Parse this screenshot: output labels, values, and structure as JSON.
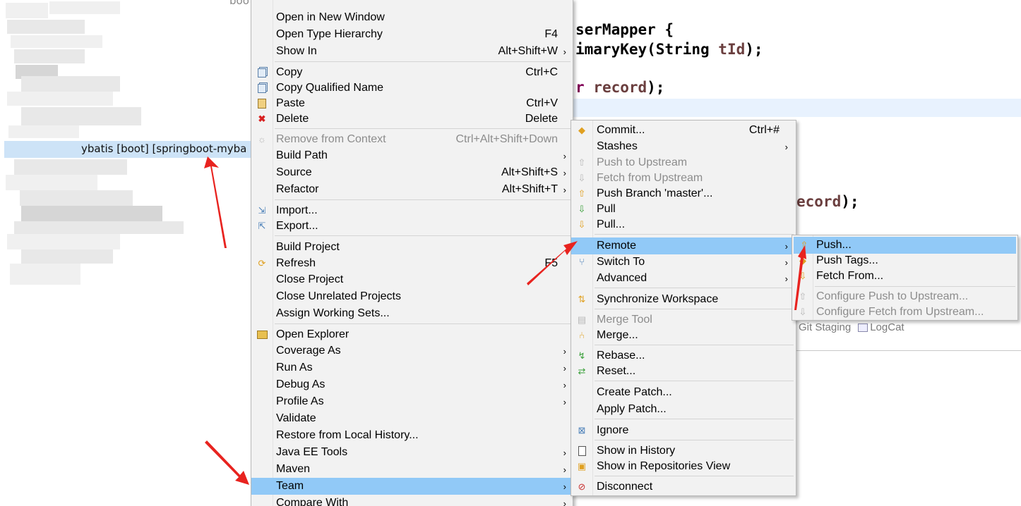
{
  "explorer": {
    "selected_item": "ybatis [boot] [springboot-myba",
    "top_crumb": "boo"
  },
  "editor": {
    "lines": [
      {
        "pre": "serMapper {",
        "kw": "",
        "var": "",
        "post": ""
      },
      {
        "pre": "imaryKey(String ",
        "kw": "",
        "var": "tId",
        "post": ");"
      },
      {
        "pre": "r ",
        "kw": "",
        "var": "record",
        "post": ");"
      },
      {
        "pre": "",
        "kw": "",
        "var": "ecord",
        "post": ");"
      }
    ],
    "views": [
      "Git Staging",
      "LogCat"
    ]
  },
  "context_menu": {
    "items": [
      {
        "label": "Open in New Window",
        "accel": "",
        "arrow": false
      },
      {
        "label": "Open Type Hierarchy",
        "accel": "F4",
        "arrow": false
      },
      {
        "label": "Show In",
        "accel": "Alt+Shift+W",
        "arrow": true
      },
      {
        "label": "Copy",
        "accel": "Ctrl+C",
        "icon": "copy-icon"
      },
      {
        "label": "Copy Qualified Name",
        "accel": "",
        "icon": "copy-icon"
      },
      {
        "label": "Paste",
        "accel": "Ctrl+V",
        "icon": "paste-icon"
      },
      {
        "label": "Delete",
        "accel": "Delete",
        "icon": "delete-icon"
      },
      {
        "label": "Remove from Context",
        "accel": "Ctrl+Alt+Shift+Down",
        "icon": "context-icon",
        "disabled": true
      },
      {
        "label": "Build Path",
        "accel": "",
        "arrow": true
      },
      {
        "label": "Source",
        "accel": "Alt+Shift+S",
        "arrow": true
      },
      {
        "label": "Refactor",
        "accel": "Alt+Shift+T",
        "arrow": true
      },
      {
        "label": "Import...",
        "accel": "",
        "icon": "import-icon"
      },
      {
        "label": "Export...",
        "accel": "",
        "icon": "export-icon"
      },
      {
        "label": "Build Project",
        "accel": ""
      },
      {
        "label": "Refresh",
        "accel": "F5",
        "icon": "refresh-icon"
      },
      {
        "label": "Close Project",
        "accel": ""
      },
      {
        "label": "Close Unrelated Projects",
        "accel": ""
      },
      {
        "label": "Assign Working Sets...",
        "accel": ""
      },
      {
        "label": "Open Explorer",
        "accel": "",
        "icon": "folder-icon"
      },
      {
        "label": "Coverage As",
        "arrow": true
      },
      {
        "label": "Run As",
        "arrow": true
      },
      {
        "label": "Debug As",
        "arrow": true
      },
      {
        "label": "Profile As",
        "arrow": true
      },
      {
        "label": "Validate"
      },
      {
        "label": "Restore from Local History..."
      },
      {
        "label": "Java EE Tools",
        "arrow": true
      },
      {
        "label": "Maven",
        "arrow": true
      },
      {
        "label": "Team",
        "arrow": true,
        "highlighted": true
      },
      {
        "label": "Compare With",
        "arrow": true
      }
    ]
  },
  "team_menu": {
    "items": [
      {
        "label": "Commit...",
        "accel": "Ctrl+#",
        "icon": "commit-icon"
      },
      {
        "label": "Stashes",
        "arrow": true
      },
      {
        "label": "Push to Upstream",
        "icon": "push-upstream-icon",
        "disabled": true
      },
      {
        "label": "Fetch from Upstream",
        "icon": "fetch-upstream-icon",
        "disabled": true
      },
      {
        "label": "Push Branch 'master'...",
        "icon": "push-branch-icon"
      },
      {
        "label": "Pull",
        "icon": "pull-icon"
      },
      {
        "label": "Pull...",
        "icon": "pull-dialog-icon"
      },
      {
        "label": "Remote",
        "arrow": true,
        "highlighted": true
      },
      {
        "label": "Switch To",
        "arrow": true,
        "icon": "switch-icon"
      },
      {
        "label": "Advanced",
        "arrow": true
      },
      {
        "label": "Synchronize Workspace",
        "icon": "sync-icon"
      },
      {
        "label": "Merge Tool",
        "icon": "merge-tool-icon",
        "disabled": true
      },
      {
        "label": "Merge...",
        "icon": "merge-icon"
      },
      {
        "label": "Rebase...",
        "icon": "rebase-icon"
      },
      {
        "label": "Reset...",
        "icon": "reset-icon"
      },
      {
        "label": "Create Patch..."
      },
      {
        "label": "Apply Patch..."
      },
      {
        "label": "Ignore",
        "icon": "ignore-icon"
      },
      {
        "label": "Show in History",
        "icon": "history-icon"
      },
      {
        "label": "Show in Repositories View",
        "icon": "repositories-icon"
      },
      {
        "label": "Disconnect",
        "icon": "disconnect-icon"
      }
    ]
  },
  "remote_menu": {
    "items": [
      {
        "label": "Push...",
        "highlighted": true,
        "icon": "push-icon"
      },
      {
        "label": "Push Tags...",
        "icon": "push-tags-icon"
      },
      {
        "label": "Fetch From...",
        "icon": "fetch-icon"
      },
      {
        "label": "Configure Push to Upstream...",
        "disabled": true,
        "icon": "configure-push-icon"
      },
      {
        "label": "Configure Fetch from Upstream...",
        "disabled": true,
        "icon": "configure-fetch-icon"
      }
    ]
  },
  "colors": {
    "highlight": "#91c9f7",
    "annotation_arrow": "#e8231f",
    "keyword": "#7f0055",
    "variable": "#6a3e3e"
  }
}
